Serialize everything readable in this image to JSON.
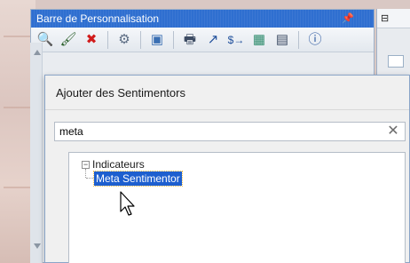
{
  "panel": {
    "title": "Barre de Personnalisation",
    "pin_icon": "pin-icon",
    "toolbar": [
      {
        "icon": "sentimentor-add-icon",
        "glyph": "🔍"
      },
      {
        "icon": "brush-icon",
        "glyph": "🖌"
      },
      {
        "icon": "delete-icon",
        "glyph": "✖"
      },
      {
        "icon": "settings-gear-icon",
        "glyph": "⚙"
      },
      {
        "icon": "template-icon",
        "glyph": "▣"
      },
      {
        "icon": "printer-icon",
        "glyph": "🖶"
      },
      {
        "icon": "trend-line-icon",
        "glyph": "↗"
      },
      {
        "icon": "dollar-arrow-icon",
        "glyph": "$→"
      },
      {
        "icon": "chart-window-icon",
        "glyph": "▦"
      },
      {
        "icon": "table-icon",
        "glyph": "▤"
      },
      {
        "icon": "info-window-icon",
        "glyph": "ⓘ"
      }
    ]
  },
  "side_panel": {
    "label": "⊟"
  },
  "dialog": {
    "title": "Ajouter des Sentimentors",
    "search": {
      "value": "meta",
      "clear_label": "✕"
    },
    "tree": {
      "root": {
        "label": "Indicateurs",
        "expander": "−"
      },
      "items": [
        {
          "label": "Meta Sentimentor",
          "selected": true
        }
      ]
    }
  },
  "colors": {
    "titlebar": "#2f6fd0",
    "selection": "#1d5fcf"
  }
}
